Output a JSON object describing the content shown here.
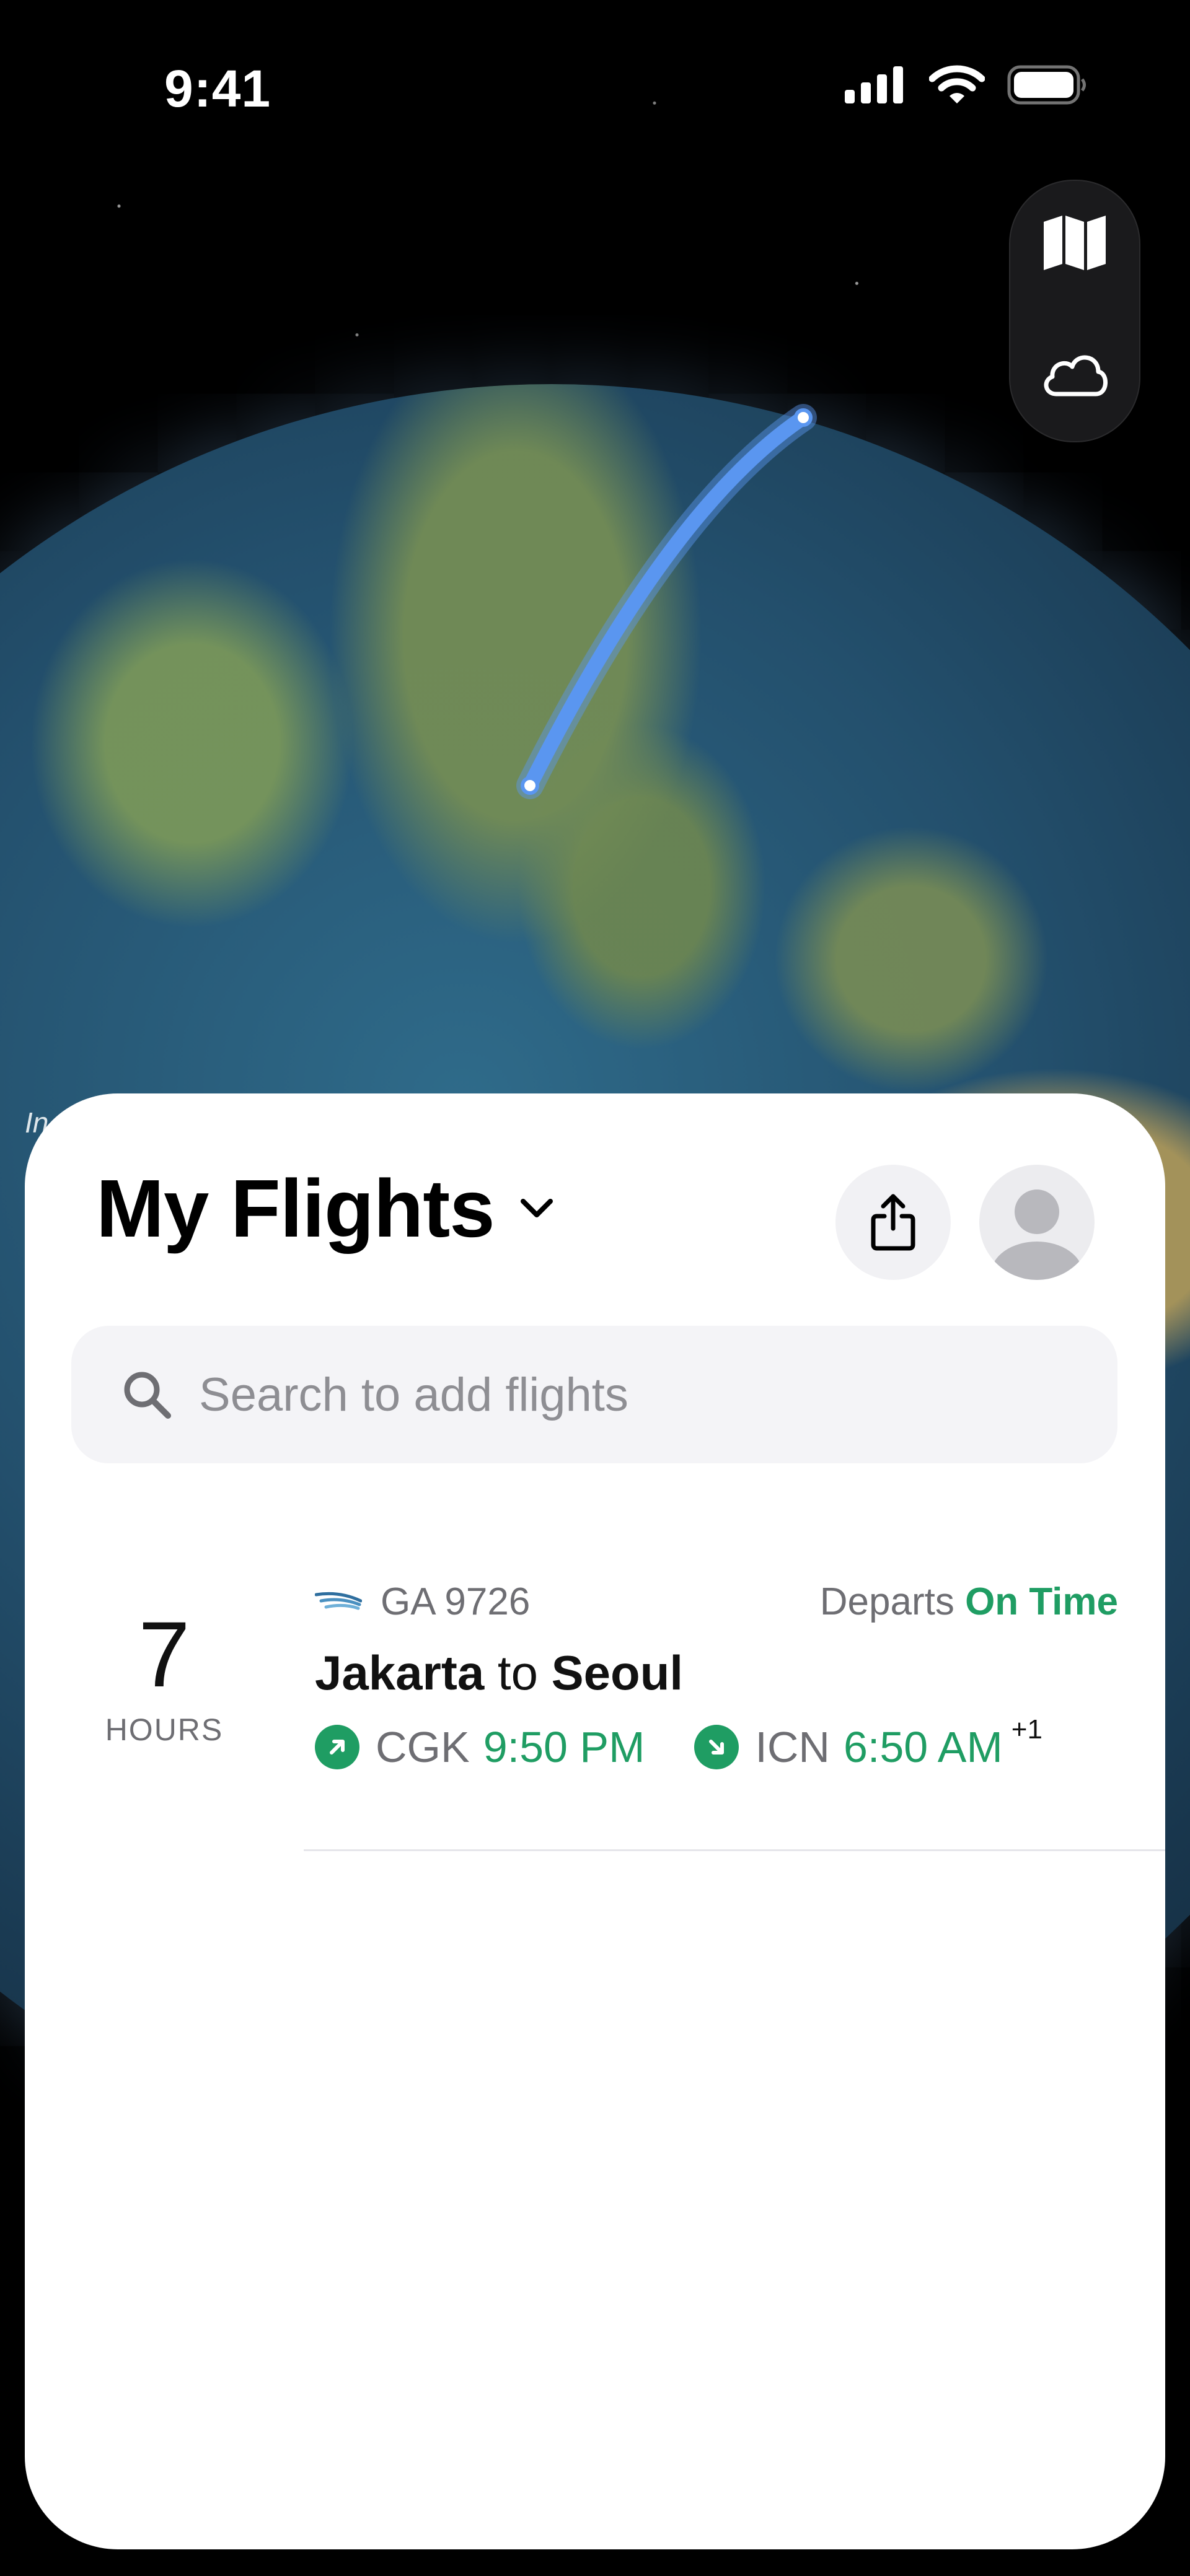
{
  "status_bar": {
    "time": "9:41"
  },
  "globe": {
    "partial_label": "In"
  },
  "map_controls": {
    "map_icon": "map-icon",
    "weather_icon": "cloud-icon"
  },
  "sheet": {
    "title": "My Flights",
    "search_placeholder": "Search to add flights"
  },
  "flights": [
    {
      "duration_value": "7",
      "duration_unit": "HOURS",
      "airline_icon": "garuda-airline-icon",
      "flight_number": "GA 9726",
      "status_prefix": "Departs",
      "status": "On Time",
      "origin_city": "Jakarta",
      "connector": "to",
      "destination_city": "Seoul",
      "origin_code": "CGK",
      "departure_time": "9:50 PM",
      "destination_code": "ICN",
      "arrival_time": "6:50 AM",
      "day_offset": "+1"
    }
  ],
  "colors": {
    "accent_green": "#1f9d63",
    "route_blue": "#5a96f0",
    "sheet_background": "#ffffff"
  }
}
